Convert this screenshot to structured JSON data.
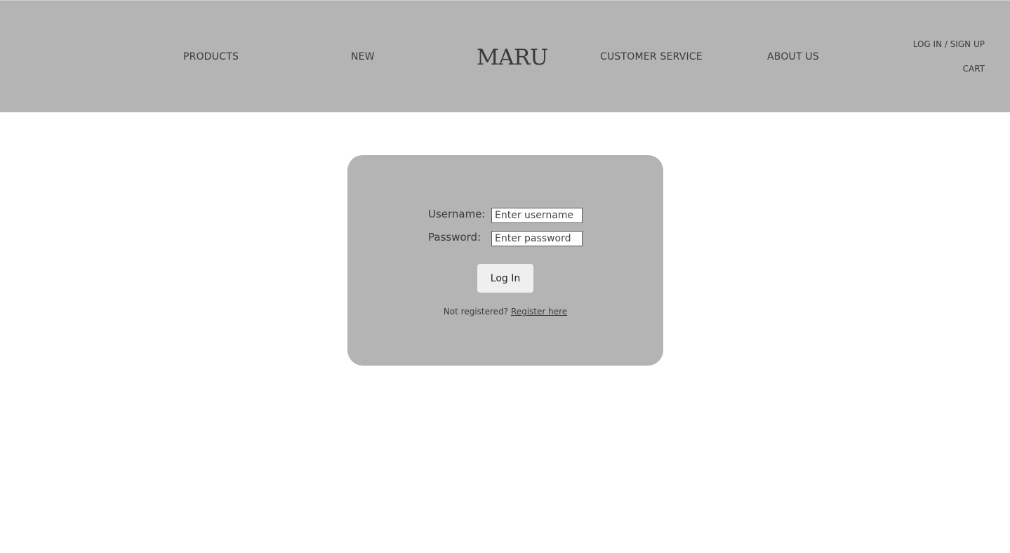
{
  "header": {
    "logo": "MARU",
    "nav": {
      "products": "PRODUCTS",
      "new": "NEW",
      "customer_service": "CUSTOMER SERVICE",
      "about_us": "ABOUT US"
    },
    "utility": {
      "login_signup": "LOG IN / SIGN UP",
      "cart": "CART"
    }
  },
  "login_form": {
    "username_label": "Username:",
    "username_value": "",
    "username_placeholder": "Enter username",
    "password_label": "Password:",
    "password_value": "",
    "password_placeholder": "Enter password",
    "submit_label": "Log In",
    "register_prompt": "Not registered?",
    "register_link": "Register here"
  },
  "colors": {
    "header_bg": "#b4b4b4",
    "card_bg": "#b4b4b4",
    "page_bg": "#ffffff",
    "text": "#3a3a3a",
    "button_bg": "#efefef"
  }
}
